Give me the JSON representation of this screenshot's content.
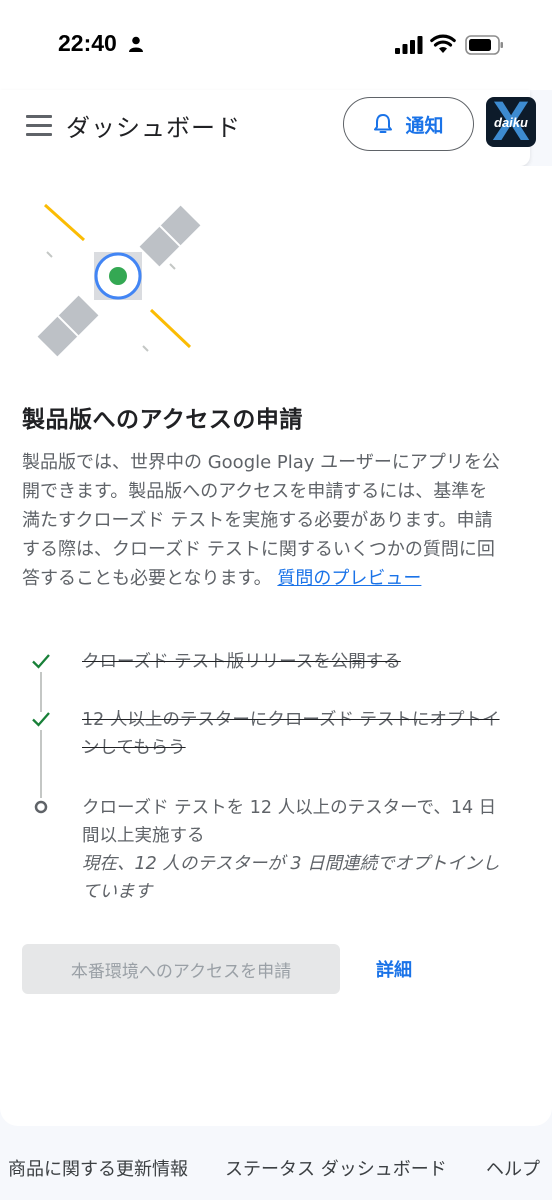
{
  "status_bar": {
    "time": "22:40"
  },
  "header": {
    "title": "ダッシュボード",
    "notify_label": "通知",
    "avatar_text": "daiku",
    "avatar_mark": "X"
  },
  "main": {
    "title": "製品版へのアクセスの申請",
    "description": "製品版では、世界中の Google Play ユーザーにアプリを公開できます。製品版へのアクセスを申請するには、基準を満たすクローズド テストを実施する必要があります。申請する際は、クローズド テストに関するいくつかの質問に回答することも必要となります。",
    "preview_link": "質問のプレビュー",
    "steps": [
      {
        "text": "クローズド テスト版リリースを公開する",
        "status": "done",
        "icon": "check-icon"
      },
      {
        "text": "12 人以上のテスターにクローズド テストにオプトインしてもらう",
        "status": "done",
        "icon": "check-icon"
      },
      {
        "text": "クローズド テストを 12 人以上のテスターで、14 日間以上実施する",
        "subtext": "現在、12 人のテスターが 3 日間連続でオプトインしています",
        "status": "pending",
        "icon": "circle-icon"
      }
    ],
    "request_button": "本番環境へのアクセスを申請",
    "details_link": "詳細"
  },
  "footer": {
    "links": [
      "商品に関する更新情報",
      "ステータス ダッシュボード",
      "ヘルプ"
    ]
  },
  "colors": {
    "accent": "#1a73e8",
    "check": "#188038",
    "satellite_dot": "#34a853",
    "satellite_ring": "#4285f4",
    "ray": "#fbbc04"
  }
}
